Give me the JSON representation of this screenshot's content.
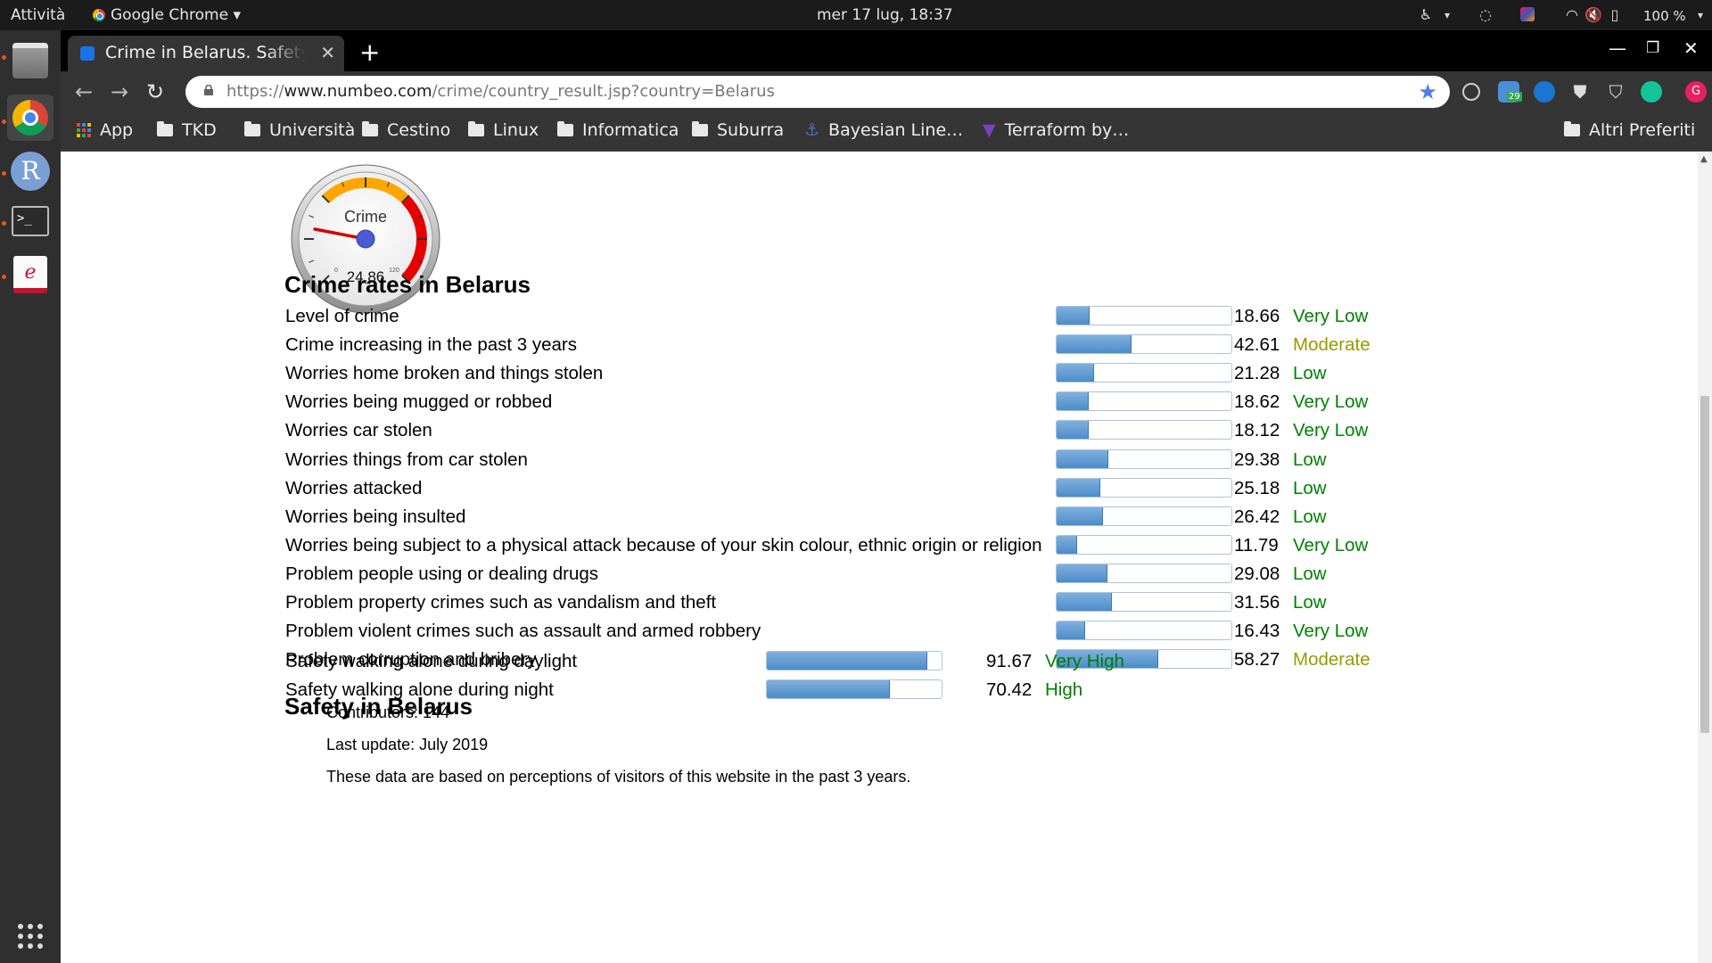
{
  "system_bar": {
    "activities": "Attività",
    "app_name": "Google Chrome",
    "clock": "mer 17 lug, 18:37",
    "battery": "100 %"
  },
  "browser": {
    "tab_title": "Crime in Belarus. Safety in Belarus",
    "url_prefix": "https://",
    "url_host": "www.numbeo.com",
    "url_path": "/crime/country_result.jsp?country=Belarus",
    "extension_badge": "29"
  },
  "bookmarks": [
    "App",
    "TKD",
    "Università",
    "Cestino",
    "Linux",
    "Informatica",
    "Suburra",
    "Bayesian Line…",
    "Terraform by…"
  ],
  "other_bookmarks": "Altri Preferiti",
  "gauge": {
    "label": "Crime",
    "value": "24,86",
    "scale_min": "0",
    "scale_max": "120",
    "needle_value": 24.86
  },
  "crime_section": {
    "title": "Crime rates in Belarus",
    "rows": [
      {
        "label": "Level of crime",
        "value": "18.66",
        "rating": "Very Low",
        "color": "#008000"
      },
      {
        "label": "Crime increasing in the past 3 years",
        "value": "42.61",
        "rating": "Moderate",
        "color": "#999900"
      },
      {
        "label": "Worries home broken and things stolen",
        "value": "21.28",
        "rating": "Low",
        "color": "#008000"
      },
      {
        "label": "Worries being mugged or robbed",
        "value": "18.62",
        "rating": "Very Low",
        "color": "#008000"
      },
      {
        "label": "Worries car stolen",
        "value": "18.12",
        "rating": "Very Low",
        "color": "#008000"
      },
      {
        "label": "Worries things from car stolen",
        "value": "29.38",
        "rating": "Low",
        "color": "#008000"
      },
      {
        "label": "Worries attacked",
        "value": "25.18",
        "rating": "Low",
        "color": "#008000"
      },
      {
        "label": "Worries being insulted",
        "value": "26.42",
        "rating": "Low",
        "color": "#008000"
      },
      {
        "label": "Worries being subject to a physical attack because of your skin colour, ethnic origin or religion",
        "value": "11.79",
        "rating": "Very Low",
        "color": "#008000"
      },
      {
        "label": "Problem people using or dealing drugs",
        "value": "29.08",
        "rating": "Low",
        "color": "#008000"
      },
      {
        "label": "Problem property crimes such as vandalism and theft",
        "value": "31.56",
        "rating": "Low",
        "color": "#008000"
      },
      {
        "label": "Problem violent crimes such as assault and armed robbery",
        "value": "16.43",
        "rating": "Very Low",
        "color": "#008000"
      },
      {
        "label": "Problem corruption and bribery",
        "value": "58.27",
        "rating": "Moderate",
        "color": "#999900"
      }
    ]
  },
  "safety_section": {
    "title": "Safety in Belarus",
    "rows": [
      {
        "label": "Safety walking alone during daylight",
        "value": "91.67",
        "rating": "Very High",
        "color": "#008000"
      },
      {
        "label": "Safety walking alone during night",
        "value": "70.42",
        "rating": "High",
        "color": "#008000"
      }
    ]
  },
  "info": {
    "contributors": "Contributors: 144",
    "last_update": "Last update: July 2019",
    "note": "These data are based on perceptions of visitors of this website in the past 3 years."
  }
}
